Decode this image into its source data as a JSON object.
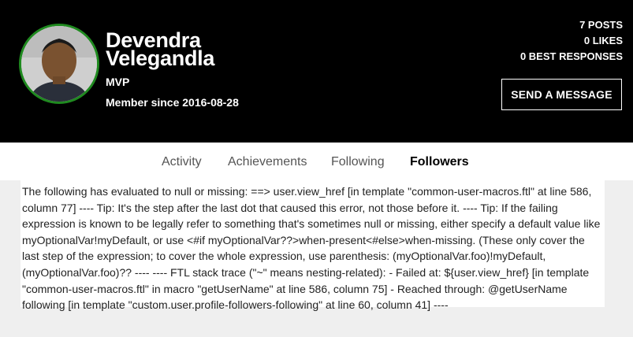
{
  "profile": {
    "name": "Devendra Velegandla",
    "rank": "MVP",
    "member_since": "Member since 2016-08-28"
  },
  "stats": {
    "posts": "7 POSTS",
    "likes": "0 LIKES",
    "best_responses": "0 BEST RESPONSES"
  },
  "actions": {
    "send_message": "SEND A MESSAGE"
  },
  "tabs": [
    {
      "label": "Activity"
    },
    {
      "label": "Achievements"
    },
    {
      "label": "Following"
    },
    {
      "label": "Followers",
      "active": true
    }
  ],
  "error_message": "The following has evaluated to null or missing: ==> user.view_href [in template \"common-user-macros.ftl\" at line 586, column 77] ---- Tip: It's the step after the last dot that caused this error, not those before it. ---- Tip: If the failing expression is known to be legally refer to something that's sometimes null or missing, either specify a default value like myOptionalVar!myDefault, or use <#if myOptionalVar??>when-present<#else>when-missing. (These only cover the last step of the expression; to cover the whole expression, use parenthesis: (myOptionalVar.foo)!myDefault, (myOptionalVar.foo)?? ---- ---- FTL stack trace (\"~\" means nesting-related): - Failed at: ${user.view_href} [in template \"common-user-macros.ftl\" in macro \"getUserName\" at line 586, column 75] - Reached through: @getUserName following [in template \"custom.user.profile-followers-following\" at line 60, column 41] ----",
  "colors": {
    "header_bg": "#000000",
    "avatar_ring": "#1f8a1f",
    "page_bg": "#efefef"
  }
}
